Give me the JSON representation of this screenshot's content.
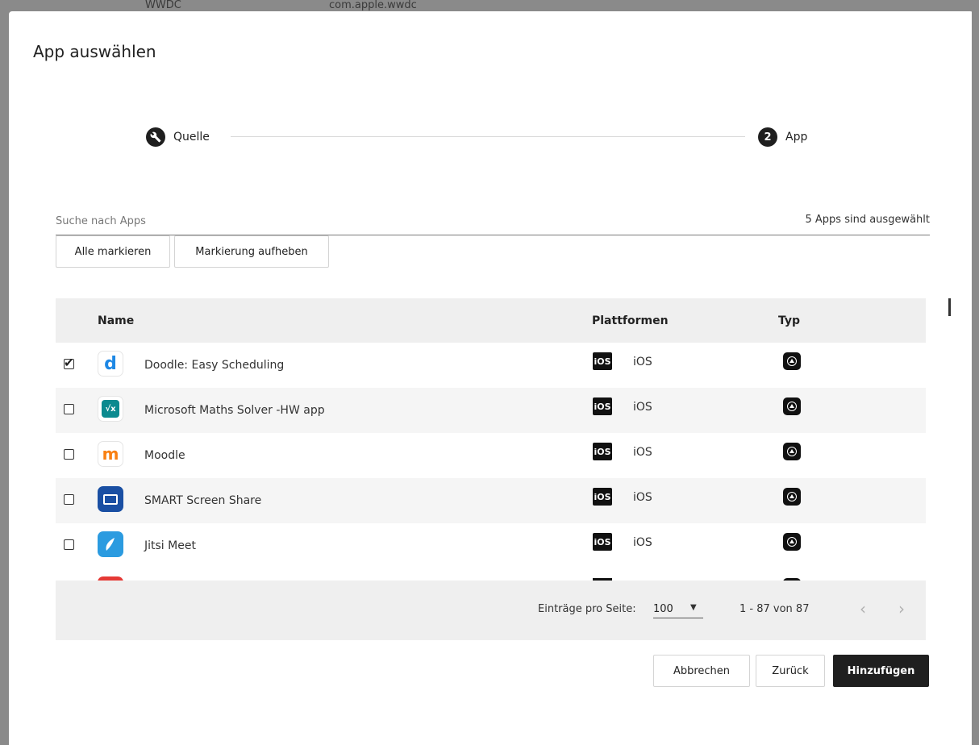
{
  "backdrop": {
    "fragment_left": "WWDC",
    "fragment_right": "com.apple.wwdc"
  },
  "dialog": {
    "title": "App auswählen"
  },
  "stepper": {
    "steps": [
      {
        "label": "Quelle",
        "icon": "wrench-icon"
      },
      {
        "label": "App",
        "number": "2"
      }
    ]
  },
  "search": {
    "placeholder": "Suche nach Apps",
    "value": ""
  },
  "selection": {
    "count_text": "5 Apps sind ausgewählt"
  },
  "actions": {
    "select_all": "Alle markieren",
    "deselect": "Markierung aufheben"
  },
  "table": {
    "columns": {
      "name": "Name",
      "platforms": "Plattformen",
      "type": "Typ"
    },
    "rows": [
      {
        "checked": true,
        "name": "Doodle: Easy Scheduling",
        "platform_badge": "iOS",
        "platform": "iOS",
        "icon": "doodle-icon"
      },
      {
        "checked": false,
        "name": "Microsoft Maths Solver -HW app",
        "platform_badge": "iOS",
        "platform": "iOS",
        "icon": "maths-solver-icon"
      },
      {
        "checked": false,
        "name": "Moodle",
        "platform_badge": "iOS",
        "platform": "iOS",
        "icon": "moodle-icon"
      },
      {
        "checked": false,
        "name": "SMART Screen Share",
        "platform_badge": "iOS",
        "platform": "iOS",
        "icon": "screen-share-icon"
      },
      {
        "checked": false,
        "name": "Jitsi Meet",
        "platform_badge": "iOS",
        "platform": "iOS",
        "icon": "jitsi-icon"
      }
    ],
    "footer": {
      "per_page_label": "Einträge pro Seite:",
      "per_page_value": "100",
      "range": "1 - 87 von 87"
    }
  },
  "buttons": {
    "cancel": "Abbrechen",
    "back": "Zurück",
    "add": "Hinzufügen"
  },
  "colors": {
    "primary": "#1f1f1f",
    "header_bg": "#efefef",
    "backdrop": "#8a8a8a"
  }
}
